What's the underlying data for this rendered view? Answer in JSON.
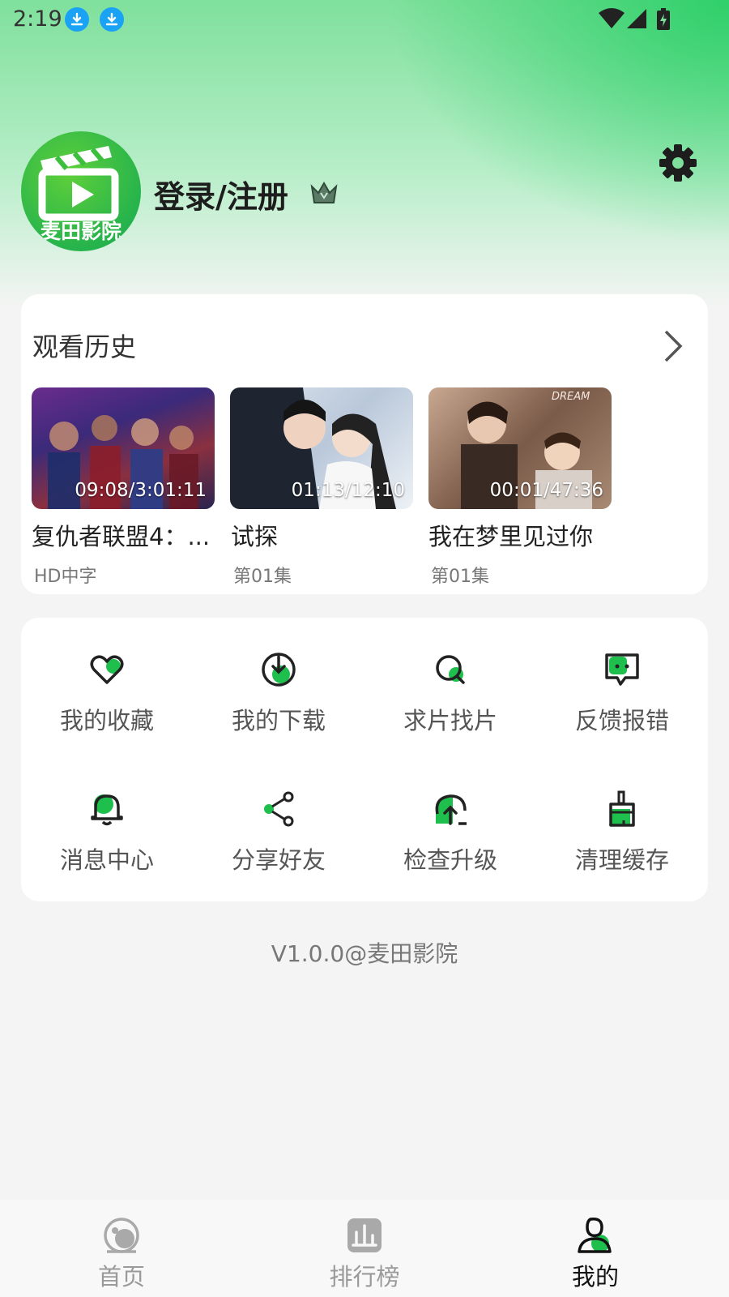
{
  "status_bar": {
    "time": "2:19",
    "icons": [
      "download-icon",
      "download-icon",
      "wifi-icon",
      "signal-icon",
      "battery-charging-icon"
    ]
  },
  "profile": {
    "avatar_text": "麦田影院",
    "login_label": "登录/注册",
    "vip_icon": "crown-icon",
    "settings_icon": "gear-icon"
  },
  "history": {
    "title": "观看历史",
    "items": [
      {
        "title": "复仇者联盟4：...",
        "progress": "09:08/3:01:11",
        "subtitle": "HD中字"
      },
      {
        "title": "试探",
        "progress": "01:13/12:10",
        "subtitle": "第01集"
      },
      {
        "title": "我在梦里见过你",
        "progress": "00:01/47:36",
        "subtitle": "第01集",
        "poster_text": "DREAM"
      }
    ]
  },
  "menu": {
    "items": [
      {
        "label": "我的收藏",
        "icon": "heart-icon"
      },
      {
        "label": "我的下载",
        "icon": "download-circle-icon"
      },
      {
        "label": "求片找片",
        "icon": "search-icon"
      },
      {
        "label": "反馈报错",
        "icon": "feedback-icon"
      },
      {
        "label": "消息中心",
        "icon": "bell-icon"
      },
      {
        "label": "分享好友",
        "icon": "share-icon"
      },
      {
        "label": "检查升级",
        "icon": "upgrade-icon"
      },
      {
        "label": "清理缓存",
        "icon": "broom-icon"
      }
    ]
  },
  "version": "V1.0.0@麦田影院",
  "tabs": [
    {
      "label": "首页",
      "icon": "home-icon",
      "active": false
    },
    {
      "label": "排行榜",
      "icon": "ranking-icon",
      "active": false
    },
    {
      "label": "我的",
      "icon": "profile-icon",
      "active": true
    }
  ],
  "colors": {
    "accent": "#1fbf4d",
    "header_green": "#2fd06a"
  }
}
